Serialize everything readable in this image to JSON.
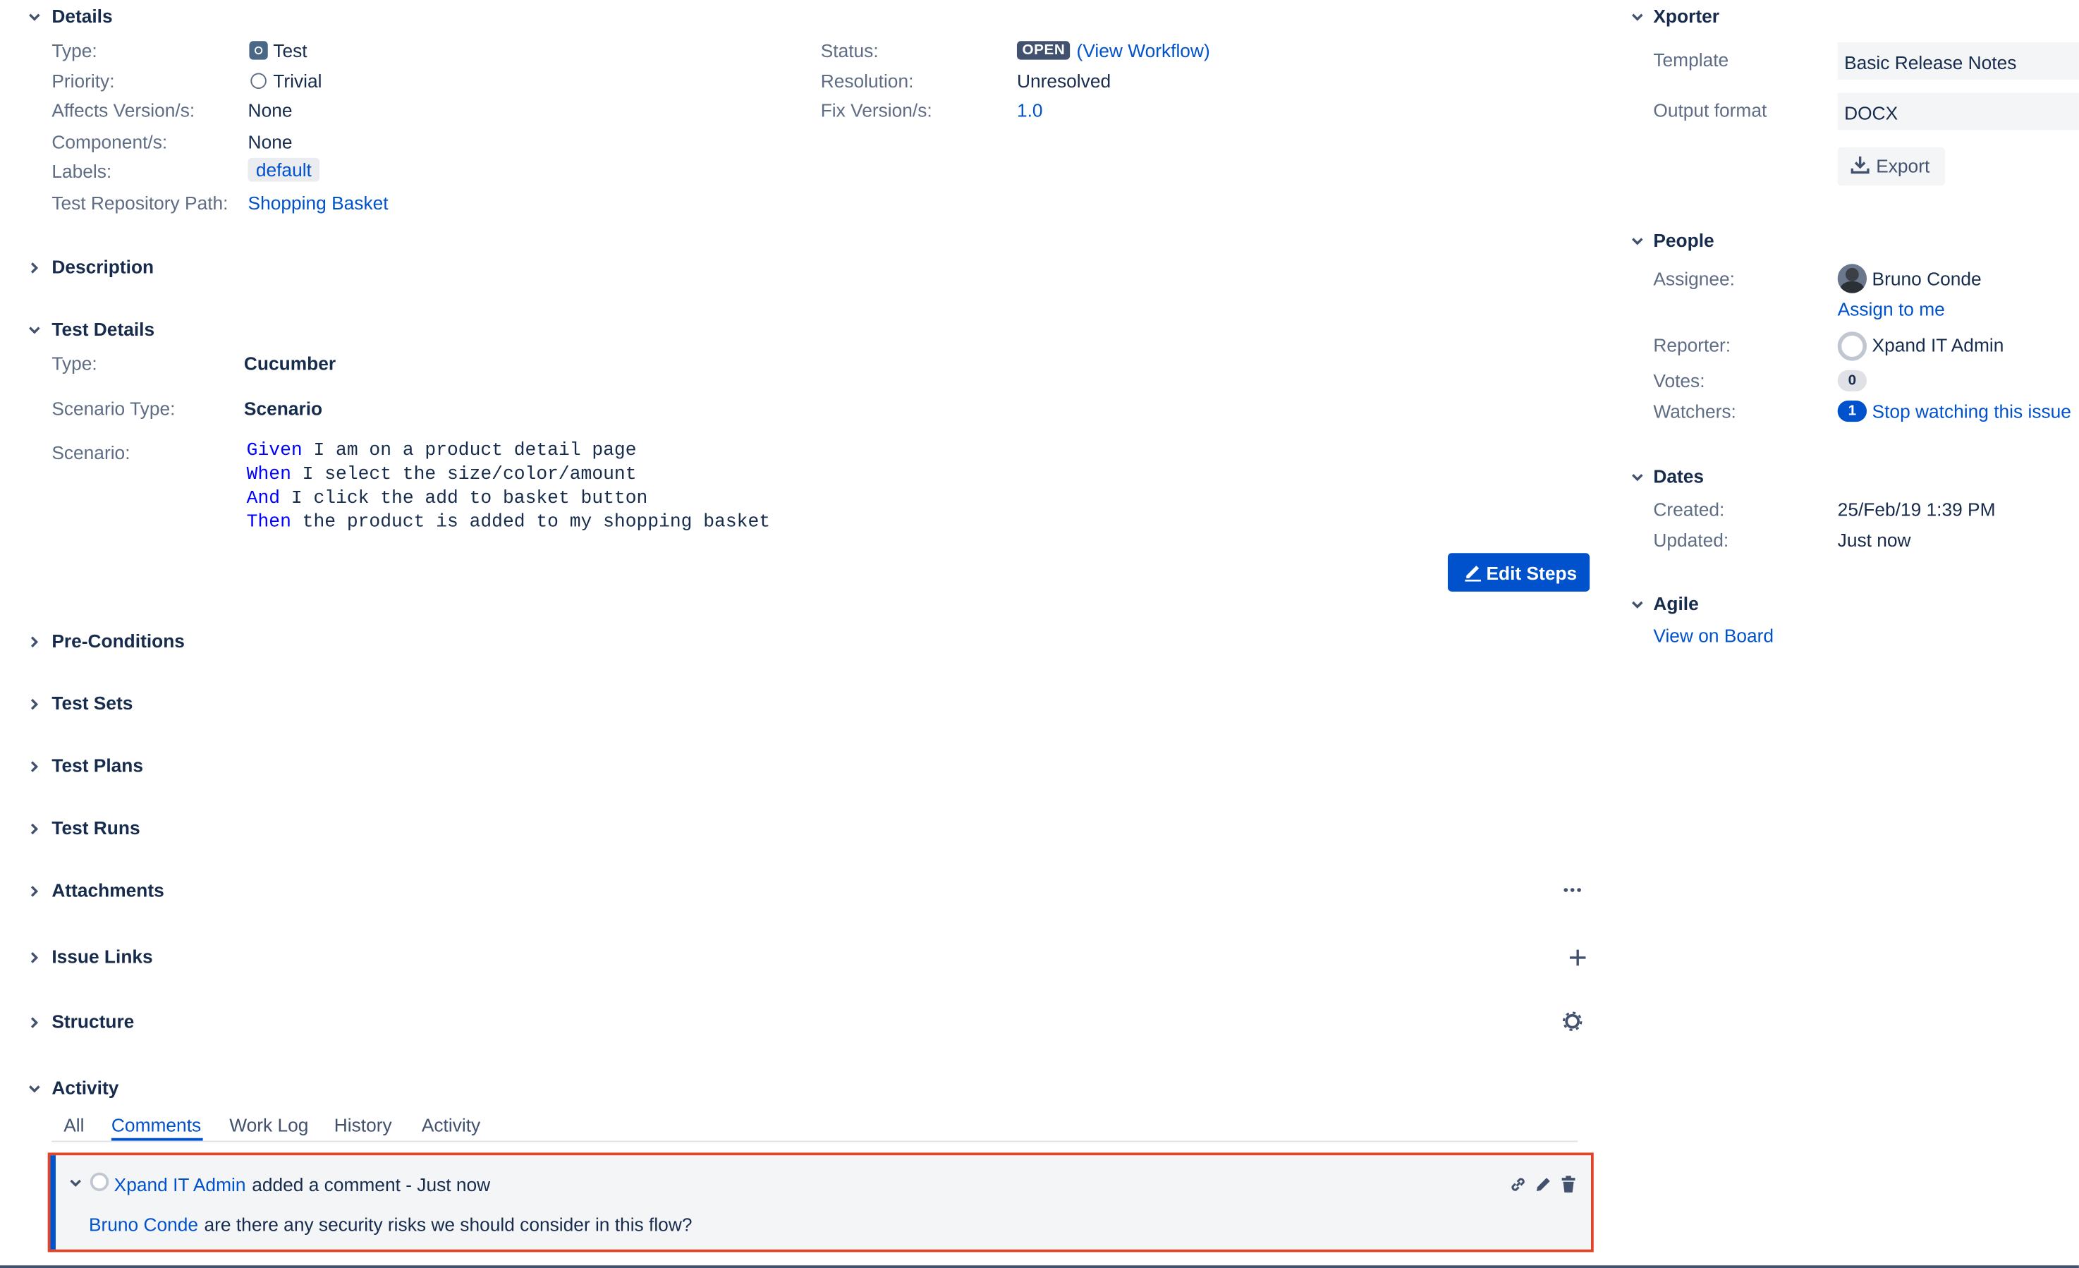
{
  "details": {
    "title": "Details",
    "type_label": "Type:",
    "type_value": "Test",
    "priority_label": "Priority:",
    "priority_value": "Trivial",
    "affects_label": "Affects Version/s:",
    "affects_value": "None",
    "component_label": "Component/s:",
    "component_value": "None",
    "labels_label": "Labels:",
    "labels_value": "default",
    "repo_label": "Test Repository Path:",
    "repo_value": "Shopping Basket",
    "status_label": "Status:",
    "status_value": "OPEN",
    "workflow_link": "(View Workflow)",
    "resolution_label": "Resolution:",
    "resolution_value": "Unresolved",
    "fix_label": "Fix Version/s:",
    "fix_value": "1.0"
  },
  "description": {
    "title": "Description"
  },
  "test_details": {
    "title": "Test Details",
    "type_label": "Type:",
    "type_value": "Cucumber",
    "scenario_type_label": "Scenario Type:",
    "scenario_type_value": "Scenario",
    "scenario_label": "Scenario:",
    "scenario_lines": [
      {
        "kw": "Given",
        "text": " I am on a product detail page"
      },
      {
        "kw": "When",
        "text": " I select the size/color/amount"
      },
      {
        "kw": "And",
        "text": " I click the add to basket button"
      },
      {
        "kw": "Then",
        "text": " the product is added to my shopping basket"
      }
    ],
    "edit_steps": "Edit Steps"
  },
  "sections": {
    "preconditions": "Pre-Conditions",
    "test_sets": "Test Sets",
    "test_plans": "Test Plans",
    "test_runs": "Test Runs",
    "attachments": "Attachments",
    "issue_links": "Issue Links",
    "structure": "Structure",
    "activity": "Activity"
  },
  "activity": {
    "tabs": [
      "All",
      "Comments",
      "Work Log",
      "History",
      "Activity"
    ],
    "active_tab": "Comments",
    "comment": {
      "author": "Xpand IT Admin",
      "action": "added a comment - Just now",
      "mention": "Bruno Conde",
      "body": "are there any security risks we should consider in this flow?"
    }
  },
  "xporter": {
    "title": "Xporter",
    "template_label": "Template",
    "template_value": "Basic Release Notes",
    "format_label": "Output format",
    "format_value": "DOCX",
    "export_button": "Export"
  },
  "people": {
    "title": "People",
    "assignee_label": "Assignee:",
    "assignee_value": "Bruno Conde",
    "assign_to_me": "Assign to me",
    "reporter_label": "Reporter:",
    "reporter_value": "Xpand IT Admin",
    "votes_label": "Votes:",
    "votes_value": "0",
    "watchers_label": "Watchers:",
    "watchers_count": "1",
    "watchers_link": "Stop watching this issue"
  },
  "dates": {
    "title": "Dates",
    "created_label": "Created:",
    "created_value": "25/Feb/19 1:39 PM",
    "updated_label": "Updated:",
    "updated_value": "Just now"
  },
  "agile": {
    "title": "Agile",
    "view_on_board": "View on Board"
  },
  "colors": {
    "link": "#0052CC",
    "primary": "#0052CC",
    "highlight_border": "#E0452A",
    "lozenge": "#42526E"
  }
}
